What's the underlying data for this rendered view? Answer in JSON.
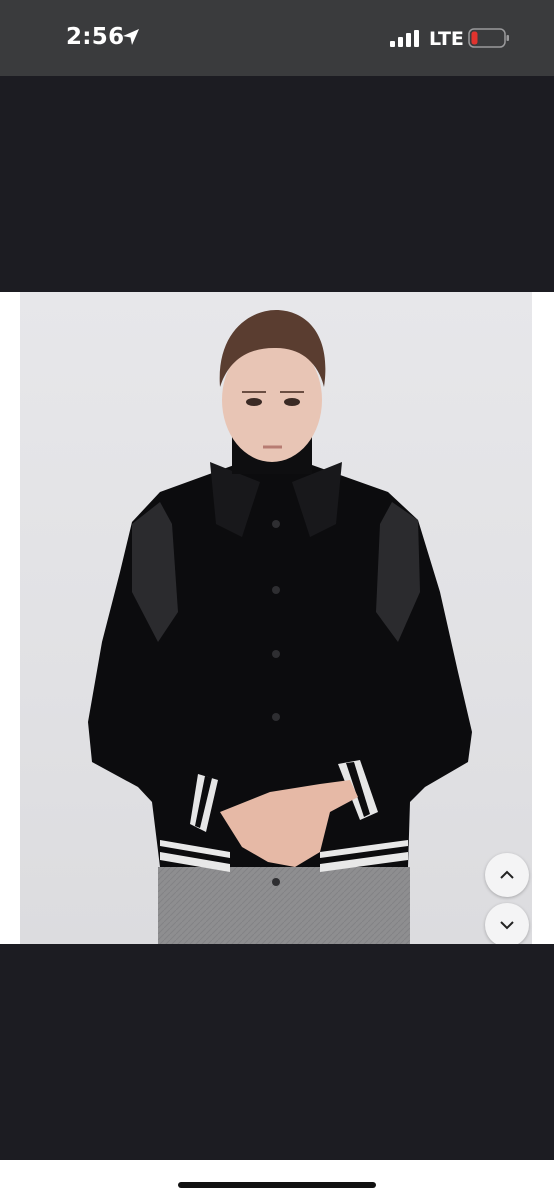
{
  "status_bar": {
    "time": "2:56",
    "network": "LTE",
    "icons": [
      "location-arrow-icon",
      "signal-icon",
      "battery-low-icon"
    ],
    "battery_color": "#e0332e"
  },
  "viewer": {
    "scroll_up_icon": "chevron-up-icon",
    "scroll_down_icon": "chevron-down-icon"
  },
  "colors": {
    "background": "#1c1c22",
    "status_bar": "#3a3b3d"
  }
}
